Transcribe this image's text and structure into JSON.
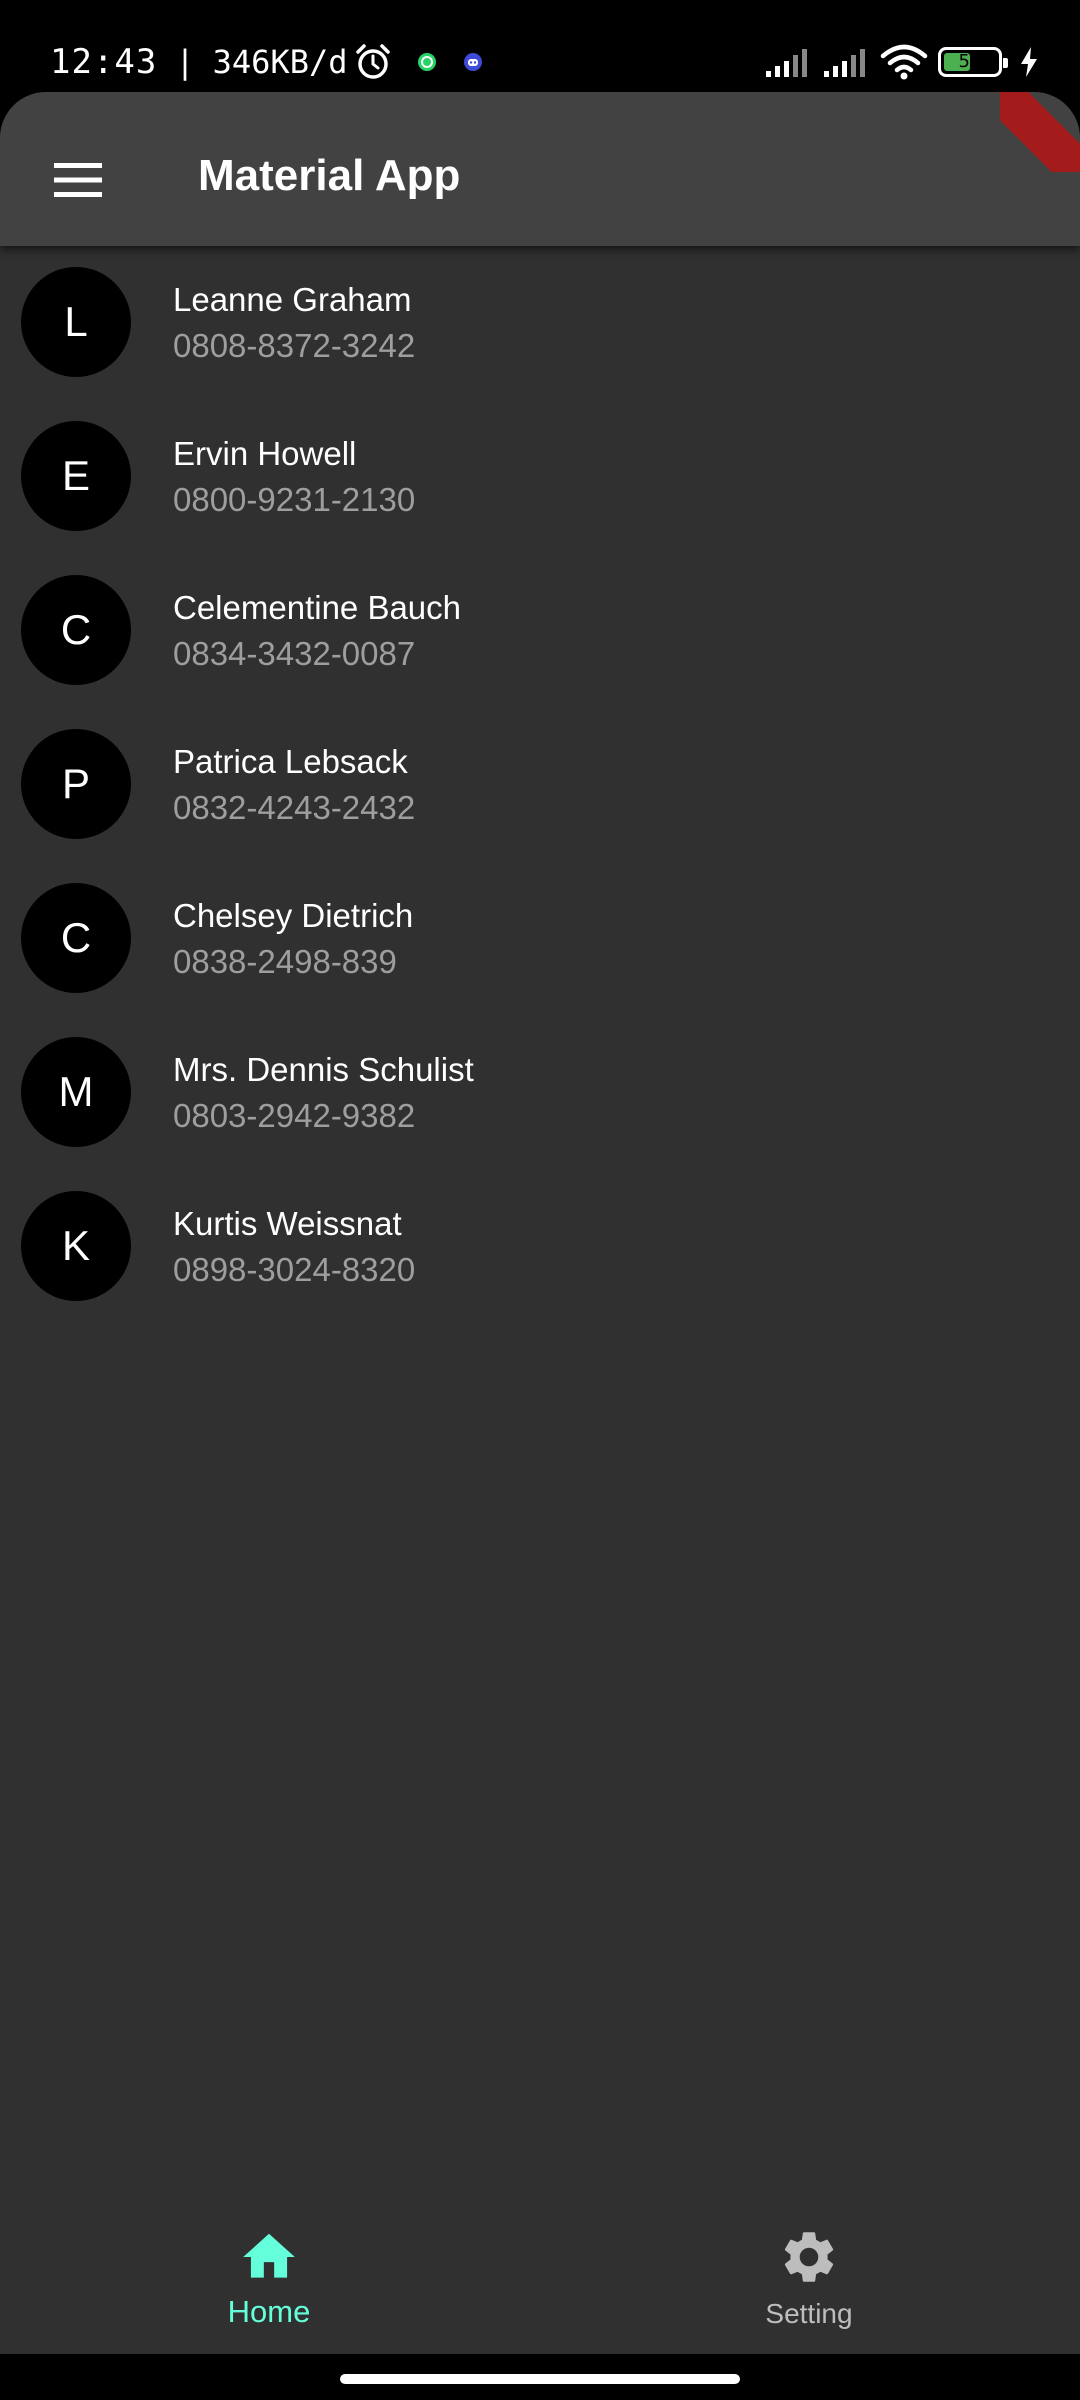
{
  "status_bar": {
    "time": "12:43",
    "separator": "|",
    "network_speed": "346KB/d",
    "battery_level": "53",
    "icons": [
      "alarm-icon",
      "whatsapp-icon",
      "discord-icon",
      "signal-icon",
      "signal-icon",
      "wifi-icon",
      "battery-icon",
      "charging-icon"
    ]
  },
  "app_bar": {
    "title": "Material App",
    "menu_icon": "menu-icon"
  },
  "contacts": [
    {
      "initial": "L",
      "name": "Leanne Graham",
      "phone": "0808-8372-3242"
    },
    {
      "initial": "E",
      "name": "Ervin Howell",
      "phone": "0800-9231-2130"
    },
    {
      "initial": "C",
      "name": "Celementine Bauch",
      "phone": "0834-3432-0087"
    },
    {
      "initial": "P",
      "name": "Patrica Lebsack",
      "phone": "0832-4243-2432"
    },
    {
      "initial": "C",
      "name": "Chelsey Dietrich",
      "phone": "0838-2498-839"
    },
    {
      "initial": "M",
      "name": "Mrs. Dennis Schulist",
      "phone": "0803-2942-9382"
    },
    {
      "initial": "K",
      "name": "Kurtis Weissnat",
      "phone": "0898-3024-8320"
    }
  ],
  "bottom_nav": {
    "items": [
      {
        "label": "Home",
        "icon": "home-icon",
        "selected": true
      },
      {
        "label": "Setting",
        "icon": "gear-icon",
        "selected": false
      }
    ]
  },
  "colors": {
    "background": "#303030",
    "app_bar": "#424242",
    "accent": "#64ffda",
    "secondary_text": "#9e9e9e",
    "avatar": "#000000"
  }
}
